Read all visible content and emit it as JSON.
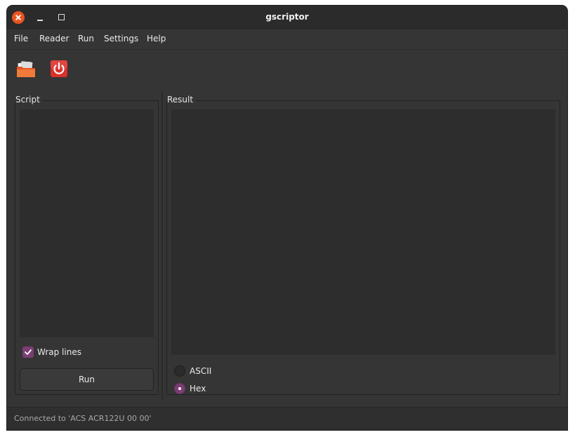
{
  "window": {
    "title": "gscriptor"
  },
  "menu": {
    "items": [
      {
        "label": "File"
      },
      {
        "label": "Reader"
      },
      {
        "label": "Run"
      },
      {
        "label": "Settings"
      },
      {
        "label": "Help"
      }
    ]
  },
  "toolbar": {
    "icons": [
      "folder-icon",
      "power-icon"
    ],
    "colors": {
      "folder": "#e95420",
      "power": "#d9302a"
    }
  },
  "script_panel": {
    "label": "Script",
    "content": "",
    "wrap_label": "Wrap lines",
    "wrap_checked": true,
    "run_label": "Run"
  },
  "result_panel": {
    "label": "Result",
    "content": "",
    "options": [
      {
        "label": "ASCII",
        "selected": false
      },
      {
        "label": "Hex",
        "selected": true
      }
    ]
  },
  "status": {
    "text": "Connected to 'ACS ACR122U 00 00'"
  },
  "colors": {
    "accent": "#7b3e73",
    "close": "#e95420",
    "background": "#353535"
  }
}
